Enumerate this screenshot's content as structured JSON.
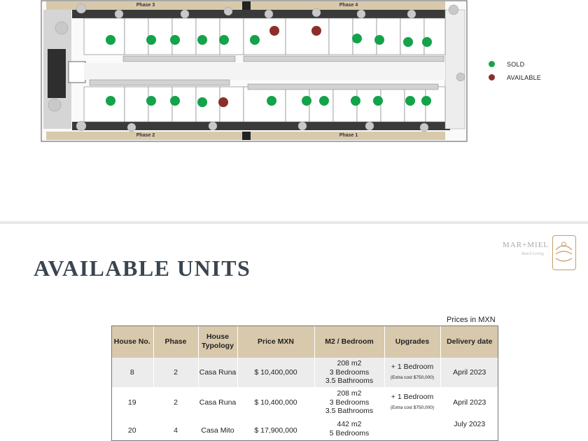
{
  "site_plan": {
    "phase_labels": {
      "phase3": "Phase 3",
      "phase4": "Phase 4",
      "phase2": "Phase 2",
      "phase1": "Phase 1"
    },
    "legend": [
      {
        "label": "SOLD",
        "color": "#13a34a"
      },
      {
        "label": "AVAILABLE",
        "color": "#8c2f2a"
      }
    ]
  },
  "header": {
    "logo_text": "MAR+MIEL",
    "logo_sub": "Beach Living",
    "title": "AVAILABLE UNITS"
  },
  "prices_note": "Prices in MXN",
  "table": {
    "headers": [
      "House No.",
      "Phase",
      "House Typology",
      "Price MXN",
      "M2 / Bedroom",
      "Upgrades",
      "Delivery date"
    ],
    "rows": [
      {
        "house": "8",
        "phase": "2",
        "typology": "Casa Runa",
        "price": "$ 10,400,000",
        "m2": "208 m2",
        "bedrooms": "3 Bedrooms",
        "bathrooms": "3.5 Bathrooms",
        "upgrade": "+ 1 Bedroom",
        "upgrade_note": "(Extra cost $750,000)",
        "delivery": "April 2023"
      },
      {
        "house": "19",
        "phase": "2",
        "typology": "Casa Runa",
        "price": "$ 10,400,000",
        "m2": "208 m2",
        "bedrooms": "3 Bedrooms",
        "bathrooms": "3.5 Bathrooms",
        "upgrade": "+ 1 Bedroom",
        "upgrade_note": "(Extra cost $750,000)",
        "delivery": "April 2023"
      },
      {
        "house": "20",
        "phase": "4",
        "typology": "Casa Mito",
        "price": "$ 17,900,000",
        "m2": "442 m2",
        "bedrooms": "5 Bedrooms",
        "bathrooms": "",
        "upgrade": "",
        "upgrade_note": "",
        "delivery": "July 2023"
      }
    ]
  }
}
